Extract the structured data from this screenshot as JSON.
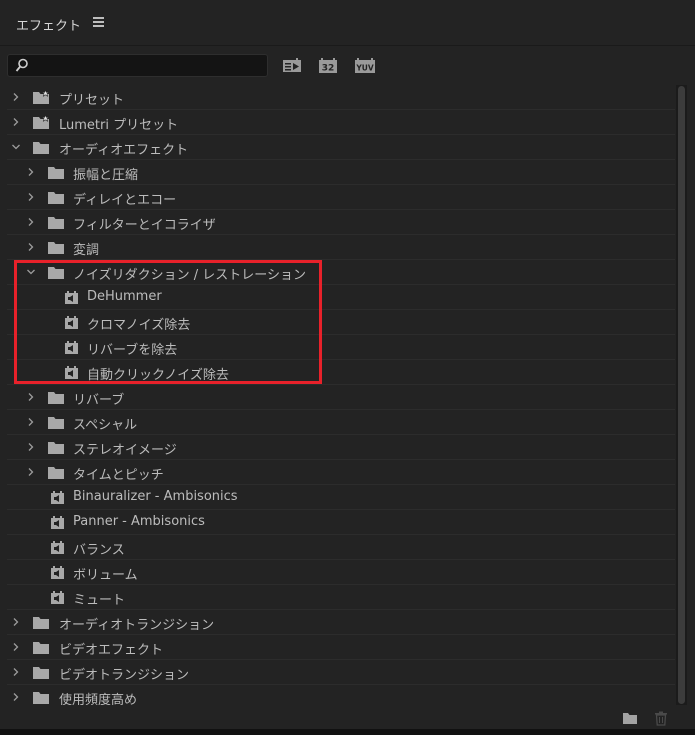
{
  "panel": {
    "title": "エフェクト"
  },
  "search": {
    "value": "",
    "placeholder": ""
  },
  "toolbar": {
    "accelerated_label": "GPU",
    "bit32_label": "32",
    "yuv_label": "YUV"
  },
  "tree": {
    "items": [
      {
        "label": "プリセット",
        "kind": "preset-folder",
        "depth": 0,
        "expanded": false
      },
      {
        "label": "Lumetri プリセット",
        "kind": "preset-folder",
        "depth": 0,
        "expanded": false
      },
      {
        "label": "オーディオエフェクト",
        "kind": "folder",
        "depth": 0,
        "expanded": true
      },
      {
        "label": "振幅と圧縮",
        "kind": "folder",
        "depth": 1,
        "expanded": false
      },
      {
        "label": "ディレイとエコー",
        "kind": "folder",
        "depth": 1,
        "expanded": false
      },
      {
        "label": "フィルターとイコライザ",
        "kind": "folder",
        "depth": 1,
        "expanded": false
      },
      {
        "label": "変調",
        "kind": "folder",
        "depth": 1,
        "expanded": false
      },
      {
        "label": "ノイズリダクション / レストレーション",
        "kind": "folder",
        "depth": 1,
        "expanded": true
      },
      {
        "label": "DeHummer",
        "kind": "effect",
        "depth": 2
      },
      {
        "label": "クロマノイズ除去",
        "kind": "effect",
        "depth": 2
      },
      {
        "label": "リバーブを除去",
        "kind": "effect",
        "depth": 2
      },
      {
        "label": "自動クリックノイズ除去",
        "kind": "effect",
        "depth": 2
      },
      {
        "label": "リバーブ",
        "kind": "folder",
        "depth": 1,
        "expanded": false
      },
      {
        "label": "スペシャル",
        "kind": "folder",
        "depth": 1,
        "expanded": false
      },
      {
        "label": "ステレオイメージ",
        "kind": "folder",
        "depth": 1,
        "expanded": false
      },
      {
        "label": "タイムとピッチ",
        "kind": "folder",
        "depth": 1,
        "expanded": false
      },
      {
        "label": "Binauralizer - Ambisonics",
        "kind": "effect",
        "depth": 1
      },
      {
        "label": "Panner - Ambisonics",
        "kind": "effect",
        "depth": 1
      },
      {
        "label": "バランス",
        "kind": "effect",
        "depth": 1
      },
      {
        "label": "ボリューム",
        "kind": "effect",
        "depth": 1
      },
      {
        "label": "ミュート",
        "kind": "effect",
        "depth": 1
      },
      {
        "label": "オーディオトランジション",
        "kind": "folder",
        "depth": 0,
        "expanded": false
      },
      {
        "label": "ビデオエフェクト",
        "kind": "folder",
        "depth": 0,
        "expanded": false
      },
      {
        "label": "ビデオトランジション",
        "kind": "folder",
        "depth": 0,
        "expanded": false
      },
      {
        "label": "使用頻度高め",
        "kind": "folder",
        "depth": 0,
        "expanded": false
      }
    ]
  },
  "footer": {
    "new_bin_icon": "new-folder-icon",
    "delete_icon": "trash-icon"
  },
  "colors": {
    "highlight": "#e8212a",
    "panel_bg": "#232323",
    "text": "#bcbcbc"
  }
}
